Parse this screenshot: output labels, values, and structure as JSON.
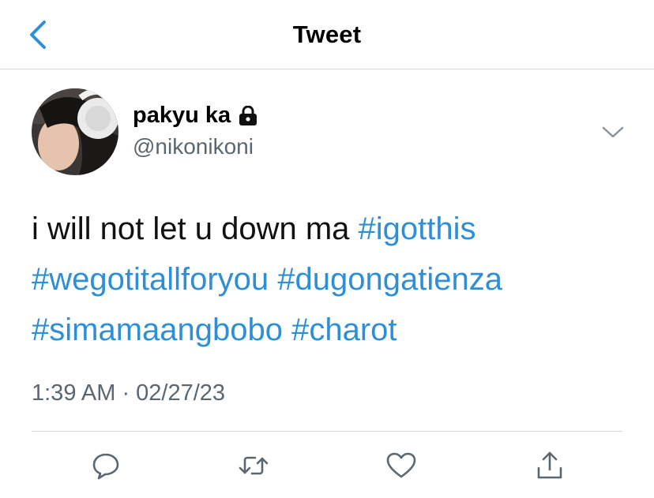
{
  "header": {
    "title": "Tweet",
    "back_icon": "chevron-left-icon"
  },
  "tweet": {
    "author": {
      "display_name": "pakyu ka",
      "handle": "@nikonikoni",
      "protected_icon": "lock-icon"
    },
    "text_parts": [
      {
        "type": "text",
        "value": "i will not let u down ma "
      },
      {
        "type": "hashtag",
        "value": "#igotthis"
      },
      {
        "type": "text",
        "value": " "
      },
      {
        "type": "hashtag",
        "value": "#wegotitallforyou"
      },
      {
        "type": "text",
        "value": " "
      },
      {
        "type": "hashtag",
        "value": "#dugongatienza"
      },
      {
        "type": "text",
        "value": " "
      },
      {
        "type": "hashtag",
        "value": "#simamaangbobo"
      },
      {
        "type": "text",
        "value": " "
      },
      {
        "type": "hashtag",
        "value": "#charot"
      }
    ],
    "timestamp": "1:39 AM · 02/27/23"
  },
  "actions": [
    "reply-icon",
    "retweet-icon",
    "like-icon",
    "share-icon"
  ],
  "colors": {
    "accent": "#2f8fd6",
    "secondary_text": "#5b6670",
    "divider": "#d6d6d6"
  }
}
